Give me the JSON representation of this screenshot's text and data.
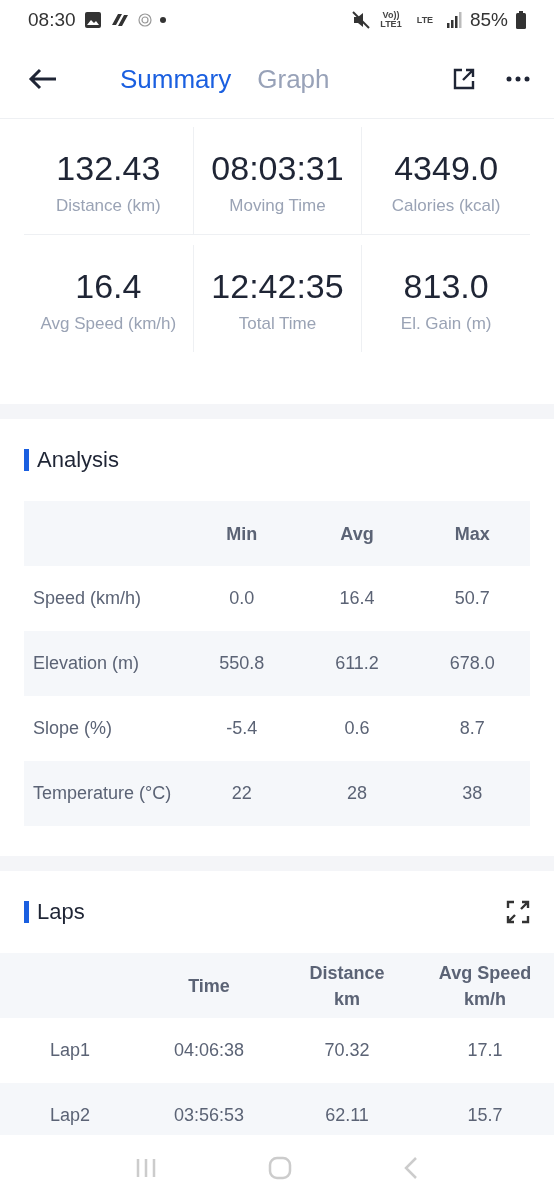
{
  "status_bar": {
    "time": "08:30",
    "volte": "Vo)) LTE1",
    "network": "LTE",
    "battery": "85%"
  },
  "header": {
    "tabs": [
      {
        "label": "Summary",
        "selected": true
      },
      {
        "label": "Graph",
        "selected": false
      }
    ]
  },
  "stats": [
    {
      "value": "132.43",
      "label": "Distance (km)"
    },
    {
      "value": "08:03:31",
      "label": "Moving Time"
    },
    {
      "value": "4349.0",
      "label": "Calories (kcal)"
    },
    {
      "value": "16.4",
      "label": "Avg Speed (km/h)"
    },
    {
      "value": "12:42:35",
      "label": "Total Time"
    },
    {
      "value": "813.0",
      "label": "El. Gain (m)"
    }
  ],
  "analysis": {
    "title": "Analysis",
    "columns": [
      "Min",
      "Avg",
      "Max"
    ],
    "rows": [
      {
        "label": "Speed (km/h)",
        "values": [
          "0.0",
          "16.4",
          "50.7"
        ]
      },
      {
        "label": "Elevation (m)",
        "values": [
          "550.8",
          "611.2",
          "678.0"
        ]
      },
      {
        "label": "Slope (%)",
        "values": [
          "-5.4",
          "0.6",
          "8.7"
        ]
      },
      {
        "label": "Temperature (°C)",
        "values": [
          "22",
          "28",
          "38"
        ]
      }
    ]
  },
  "laps": {
    "title": "Laps",
    "columns": [
      [
        "Time"
      ],
      [
        "Distance",
        "km"
      ],
      [
        "Avg Speed",
        "km/h"
      ]
    ],
    "rows": [
      {
        "label": "Lap1",
        "values": [
          "04:06:38",
          "70.32",
          "17.1"
        ]
      },
      {
        "label": "Lap2",
        "values": [
          "03:56:53",
          "62.11",
          "15.7"
        ]
      }
    ]
  }
}
